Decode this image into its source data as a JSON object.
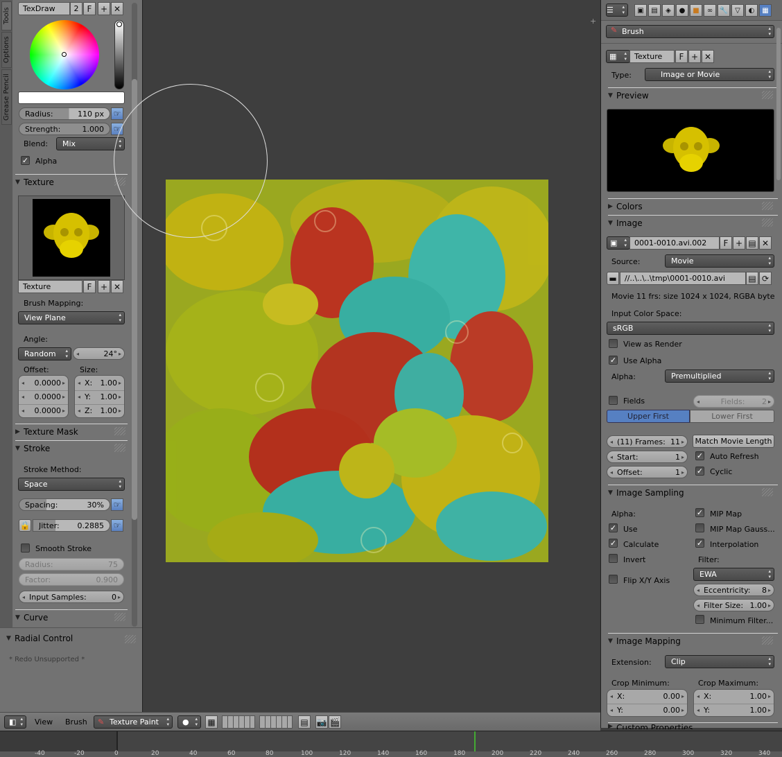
{
  "left": {
    "tabs": [
      "Tools",
      "Options",
      "Grease Pencil"
    ],
    "brush": {
      "name": "TexDraw",
      "users": "2",
      "fake": "F"
    },
    "radius": {
      "label": "Radius:",
      "value": "110 px"
    },
    "strength": {
      "label": "Strength:",
      "value": "1.000"
    },
    "blend": {
      "label": "Blend:",
      "value": "Mix"
    },
    "alpha": {
      "label": "Alpha",
      "checked": true
    },
    "texture_panel": {
      "title": "Texture",
      "texture_name": "Texture",
      "fake": "F",
      "mapping_label": "Brush Mapping:",
      "mapping_value": "View Plane",
      "angle_label": "Angle:",
      "angle_mode": "Random",
      "angle_value": "24°",
      "offset_label": "Offset:",
      "size_label": "Size:",
      "offsets": [
        "0.0000",
        "0.0000",
        "0.0000"
      ],
      "sizes": [
        {
          "axis": "X:",
          "value": "1.00"
        },
        {
          "axis": "Y:",
          "value": "1.00"
        },
        {
          "axis": "Z:",
          "value": "1.00"
        }
      ]
    },
    "texture_mask": "Texture Mask",
    "stroke": {
      "title": "Stroke",
      "method_label": "Stroke Method:",
      "method_value": "Space",
      "spacing_label": "Spacing:",
      "spacing_value": "30%",
      "jitter_label": "Jitter:",
      "jitter_value": "0.2885",
      "smooth_label": "Smooth Stroke",
      "smooth_radius_label": "Radius:",
      "smooth_radius_value": "75",
      "factor_label": "Factor:",
      "factor_value": "0.900",
      "input_samples_label": "Input Samples:",
      "input_samples_value": "0"
    },
    "curve": "Curve",
    "radial_control": "Radial Control",
    "redo": "* Redo Unsupported *"
  },
  "right": {
    "brush_label": "Brush",
    "texture_name": "Texture",
    "fake": "F",
    "type_label": "Type:",
    "type_value": "Image or Movie",
    "preview_title": "Preview",
    "colors_title": "Colors",
    "image_title": "Image",
    "image_name": "0001-0010.avi.002",
    "image_fake": "F",
    "source_label": "Source:",
    "source_value": "Movie",
    "filepath": "//..\\..\\..\\tmp\\0001-0010.avi",
    "info": "Movie 11 frs: size 1024 x 1024, RGBA byte",
    "color_space_label": "Input Color Space:",
    "color_space_value": "sRGB",
    "view_as_render": "View as Render",
    "use_alpha": "Use Alpha",
    "alpha_label": "Alpha:",
    "alpha_value": "Premultiplied",
    "fields_label": "Fields",
    "fields_count_label": "Fields:",
    "fields_count_value": "2",
    "upper_first": "Upper First",
    "lower_first": "Lower First",
    "frames_label": "(11) Frames:",
    "frames_value": "11",
    "match_length": "Match Movie Length",
    "start_label": "Start:",
    "start_value": "1",
    "auto_refresh": "Auto Refresh",
    "offset_label": "Offset:",
    "offset_value": "1",
    "cyclic": "Cyclic",
    "sampling_title": "Image Sampling",
    "alpha_section": "Alpha:",
    "mip_map": "MIP Map",
    "use": "Use",
    "mip_gauss": "MIP Map Gauss...",
    "calculate": "Calculate",
    "interpolation": "Interpolation",
    "invert": "Invert",
    "filter_label": "Filter:",
    "filter_value": "EWA",
    "flip_xy": "Flip X/Y Axis",
    "eccentricity_label": "Eccentricity:",
    "eccentricity_value": "8",
    "filter_size_label": "Filter Size:",
    "filter_size_value": "1.00",
    "min_filter": "Minimum Filter...",
    "mapping_title": "Image Mapping",
    "extension_label": "Extension:",
    "extension_value": "Clip",
    "crop_min_label": "Crop Minimum:",
    "crop_max_label": "Crop Maximum:",
    "crop_min_x": "0.00",
    "crop_min_y": "0.00",
    "crop_max_x": "1.00",
    "crop_max_y": "1.00",
    "custom_props": "Custom Properties"
  },
  "bottom": {
    "view": "View",
    "brush": "Brush",
    "mode": "Texture Paint",
    "ticks": [
      "-40",
      "-20",
      "0",
      "20",
      "40",
      "60",
      "80",
      "100",
      "120",
      "140",
      "160",
      "180",
      "200",
      "220",
      "240",
      "260",
      "280",
      "300",
      "320",
      "340"
    ]
  },
  "colors": {
    "accent_blue": "#5680c2",
    "timeline_marker": "#44aa33",
    "brush_circle": "#dddddd"
  }
}
